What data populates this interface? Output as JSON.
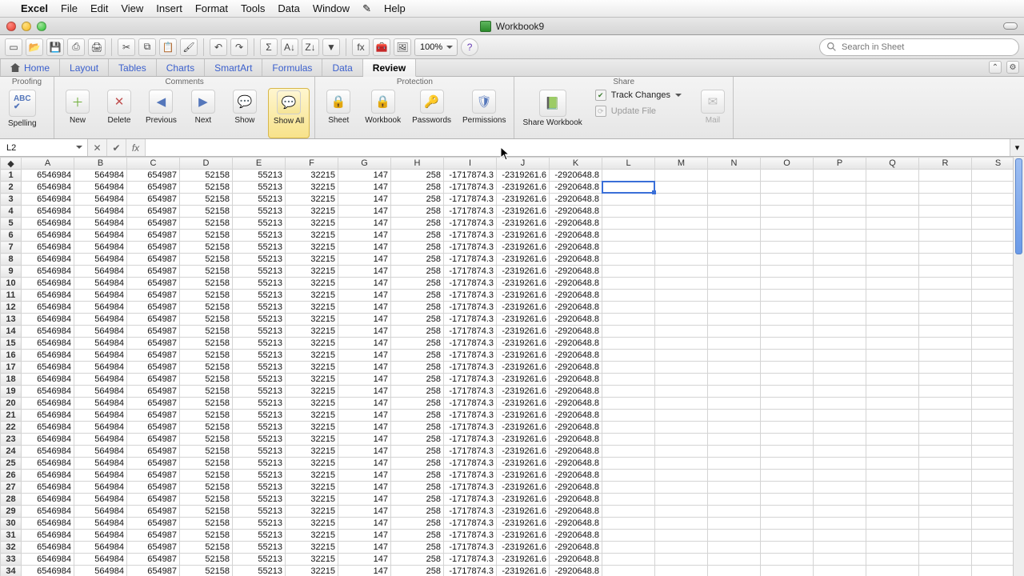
{
  "menubar": {
    "app_name": "Excel",
    "items": [
      "File",
      "Edit",
      "View",
      "Insert",
      "Format",
      "Tools",
      "Data",
      "Window",
      "Help"
    ],
    "script_icon": "✎"
  },
  "window": {
    "title": "Workbook9"
  },
  "toolbar": {
    "zoom": "100%",
    "search_placeholder": "Search in Sheet"
  },
  "ribbon": {
    "tabs": [
      "Home",
      "Layout",
      "Tables",
      "Charts",
      "SmartArt",
      "Formulas",
      "Data",
      "Review"
    ],
    "active_tab": "Review",
    "groups": {
      "proofing": {
        "label": "Proofing",
        "spelling": "Spelling"
      },
      "comments": {
        "label": "Comments",
        "new": "New",
        "delete": "Delete",
        "previous": "Previous",
        "next": "Next",
        "show": "Show",
        "show_all": "Show All"
      },
      "protection": {
        "label": "Protection",
        "sheet": "Sheet",
        "workbook": "Workbook",
        "passwords": "Passwords",
        "permissions": "Permissions"
      },
      "share": {
        "label": "Share",
        "share_workbook": "Share Workbook",
        "track_changes": "Track Changes",
        "update_file": "Update File",
        "mail": "Mail"
      }
    }
  },
  "formula_bar": {
    "name_box": "L2",
    "formula": ""
  },
  "grid": {
    "columns": [
      "A",
      "B",
      "C",
      "D",
      "E",
      "F",
      "G",
      "H",
      "I",
      "J",
      "K",
      "L",
      "M",
      "N",
      "O",
      "P",
      "Q",
      "R",
      "S"
    ],
    "row_count": 34,
    "row_values": [
      "6546984",
      "564984",
      "654987",
      "52158",
      "55213",
      "32215",
      "147",
      "258",
      "-1717874.3",
      "-2319261.6",
      "-2920648.8"
    ],
    "active_cell": "L2"
  }
}
